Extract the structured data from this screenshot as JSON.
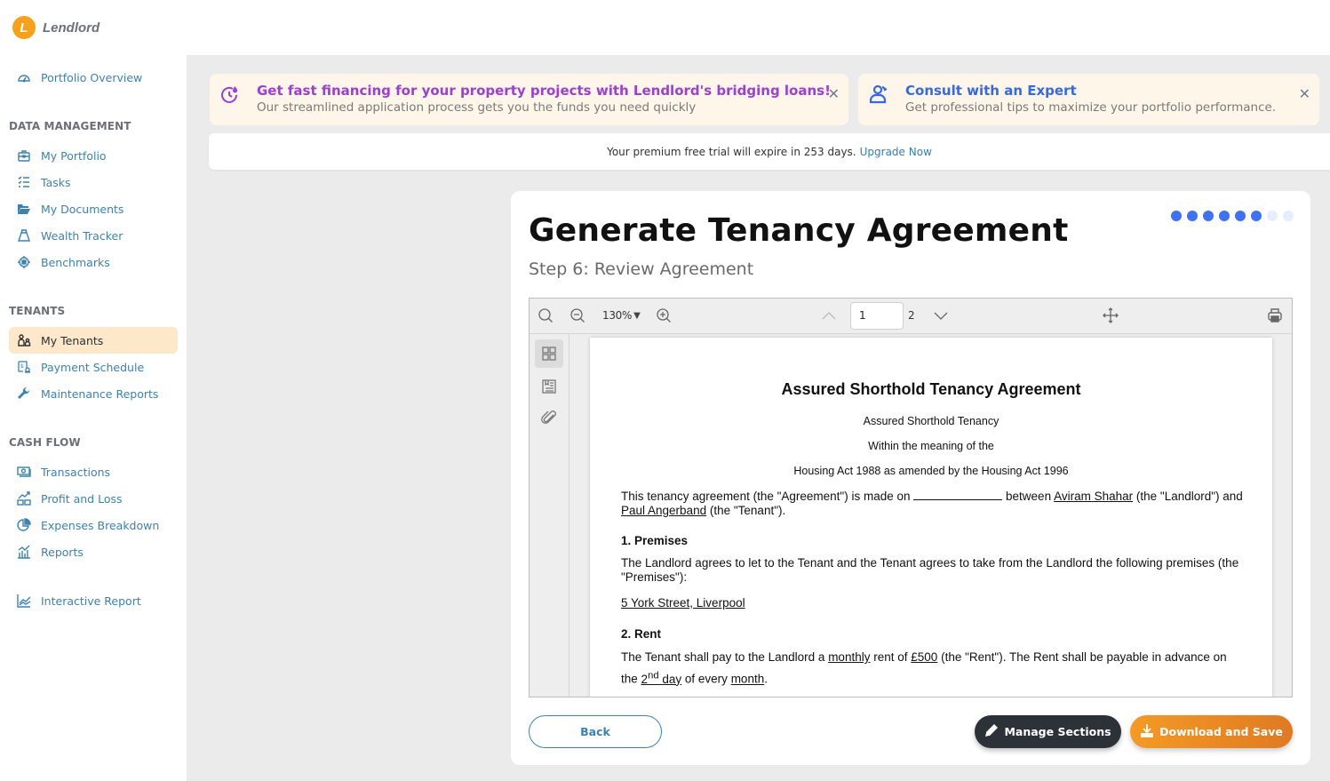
{
  "app": {
    "name": "Lendlord",
    "logo_letter": "L"
  },
  "sidebar": {
    "top_item": {
      "label": "Portfolio Overview",
      "icon": "dashboard-gauge-icon"
    },
    "sections": [
      {
        "title": "DATA MANAGEMENT",
        "items": [
          {
            "label": "My Portfolio",
            "icon": "briefcase-icon"
          },
          {
            "label": "Tasks",
            "icon": "checklist-icon"
          },
          {
            "label": "My Documents",
            "icon": "folder-open-icon"
          },
          {
            "label": "Wealth Tracker",
            "icon": "money-bag-icon"
          },
          {
            "label": "Benchmarks",
            "icon": "benchmark-icon"
          }
        ]
      },
      {
        "title": "TENANTS",
        "items": [
          {
            "label": "My Tenants",
            "icon": "tenants-icon",
            "active": true
          },
          {
            "label": "Payment Schedule",
            "icon": "payment-schedule-icon"
          },
          {
            "label": "Maintenance Reports",
            "icon": "wrench-icon"
          }
        ]
      },
      {
        "title": "CASH FLOW",
        "items": [
          {
            "label": "Transactions",
            "icon": "cash-icon"
          },
          {
            "label": "Profit and Loss",
            "icon": "profit-loss-icon"
          },
          {
            "label": "Expenses Breakdown",
            "icon": "pie-chart-icon"
          },
          {
            "label": "Reports",
            "icon": "bar-chart-icon"
          }
        ]
      }
    ],
    "bottom_item": {
      "label": "Interactive Report",
      "icon": "line-chart-icon"
    }
  },
  "promos": [
    {
      "title": "Get fast financing for your property projects with Lendlord's bridging loans!",
      "subtitle": "Our streamlined application process gets you the funds you need quickly",
      "icon": "fast-fire-icon",
      "color": "#9b3fd6"
    },
    {
      "title": "Consult with an Expert",
      "subtitle": "Get professional tips to maximize your portfolio performance.",
      "icon": "expert-user-icon",
      "color": "#3468f0"
    }
  ],
  "trial": {
    "message": "Your premium free trial will expire in 253 days.",
    "link": "Upgrade Now"
  },
  "wizard": {
    "title": "Generate Tenancy Agreement",
    "step_label": "Step 6: Review Agreement",
    "current_step": 6,
    "total_steps": 8
  },
  "viewer": {
    "zoom": "130%",
    "current_page": "1",
    "total_pages": "2"
  },
  "document": {
    "title": "Assured Shorthold Tenancy Agreement",
    "center_lines": [
      "Assured Shorthold Tenancy",
      "Within the meaning of the",
      "Housing Act 1988 as amended by the Housing Act 1996"
    ],
    "intro": {
      "p1": "This tenancy agreement (the \"Agreement\") is made on",
      "p2": "between",
      "landlord": "Aviram Shahar",
      "p3": "(the \"Landlord\") and",
      "tenant": "Paul Angerband",
      "p4": "(the \"Tenant\")."
    },
    "sections": {
      "premises_heading": "1. Premises",
      "premises_text": "The Landlord agrees to let to the Tenant and the Tenant agrees to take from the Landlord the following premises (the \"Premises\"):",
      "premises_address": "5 York Street, Liverpool",
      "rent_heading": "2. Rent",
      "rent_p1": "The Tenant shall pay to the Landlord a",
      "rent_frequency": "monthly",
      "rent_p2": "rent of",
      "rent_amount": "£500",
      "rent_p3": "(the \"Rent\"). The Rent shall be payable in advance on the",
      "rent_day": "2",
      "rent_day_suffix": "nd",
      "rent_day_word": "day",
      "rent_p4": "of every",
      "rent_period": "month",
      "rent_p5": "."
    }
  },
  "buttons": {
    "back": "Back",
    "manage": "Manage Sections",
    "download": "Download and Save"
  }
}
